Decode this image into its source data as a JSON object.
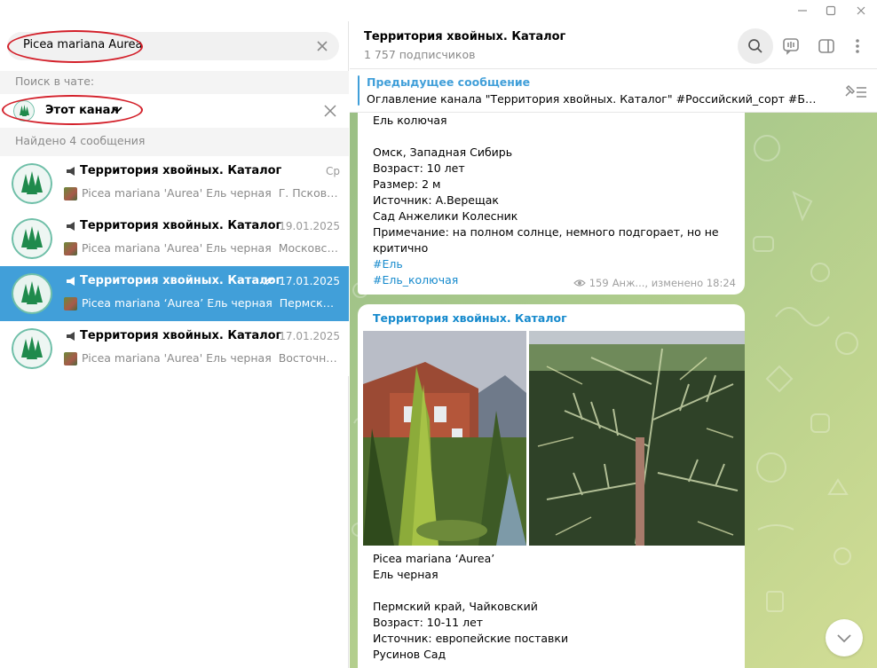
{
  "window": {
    "controls": [
      "minimize-icon",
      "maximize-icon",
      "close-icon"
    ]
  },
  "search": {
    "query": "Picea mariana Aurea",
    "search_in_label": "Поиск в чате:",
    "scope_label": "Этот канал",
    "found_label": "Найдено 4 сообщения"
  },
  "results": [
    {
      "title": "Территория хвойных. Каталог",
      "date": "Ср",
      "snippet_head": "Picea mariana 'Aurea' Ель черная",
      "snippet_rest": "Г. Псков Воз...",
      "active": false,
      "read_mark": false
    },
    {
      "title": "Территория хвойных. Каталог",
      "date": "19.01.2025",
      "snippet_head": "Picea mariana 'Aurea' Ель черная",
      "snippet_rest": "Московская...",
      "active": false,
      "read_mark": false
    },
    {
      "title": "Территория хвойных. Каталог",
      "date": "17.01.2025",
      "snippet_head": "Picea mariana ‘Aurea’ Ель черная",
      "snippet_rest": "Пермский к...",
      "active": true,
      "read_mark": true
    },
    {
      "title": "Территория хвойных. Каталог",
      "date": "17.01.2025",
      "snippet_head": "Picea mariana 'Aurea'  Ель черная",
      "snippet_rest": "Восточная ...",
      "active": false,
      "read_mark": false
    }
  ],
  "chat": {
    "title": "Территория хвойных. Каталог",
    "subscribers": "1 757 подписчиков",
    "header_icons": [
      "search-icon",
      "live-stream-icon",
      "side-panel-icon",
      "more-icon"
    ]
  },
  "pinned": {
    "title": "Предыдущее сообщение",
    "text": "Оглавление канала \"Территория хвойных. Каталог\"  #Российский_сорт #Белорус..."
  },
  "message1": {
    "lines": [
      {
        "text": "Ель колючая",
        "hashtag": false
      },
      {
        "text": "",
        "hashtag": false
      },
      {
        "text": "Омск, Западная Сибирь",
        "hashtag": false
      },
      {
        "text": "Возраст: 10 лет",
        "hashtag": false
      },
      {
        "text": "Размер: 2 м",
        "hashtag": false
      },
      {
        "text": "Источник: А.Верещак",
        "hashtag": false
      },
      {
        "text": "Сад Анжелики Колесник",
        "hashtag": false
      },
      {
        "text": "Примечание: на полном солнце, немного подгорает, но не",
        "hashtag": false
      },
      {
        "text": "критично",
        "hashtag": false
      },
      {
        "text": "#Ель",
        "hashtag": true
      },
      {
        "text": "#Ель_колючая",
        "hashtag": true
      }
    ],
    "views": "159",
    "meta": "Анж..., изменено 18:24"
  },
  "message2": {
    "author": "Территория хвойных. Каталог",
    "lines": [
      {
        "text": "Picea mariana ‘Aurea’",
        "hashtag": false
      },
      {
        "text": "Ель черная",
        "hashtag": false
      },
      {
        "text": "",
        "hashtag": false
      },
      {
        "text": "Пермский край, Чайковский",
        "hashtag": false
      },
      {
        "text": "Возраст: 10-11 лет",
        "hashtag": false
      },
      {
        "text": "Источник: европейские поставки",
        "hashtag": false
      },
      {
        "text": "Русинов Сад",
        "hashtag": false
      }
    ]
  },
  "colors": {
    "accent": "#419fd9",
    "link": "#168acd",
    "annotation": "#d3202a",
    "avatar_ring": "#6fbfa8",
    "avatar_tree": "#1f8a4c"
  }
}
